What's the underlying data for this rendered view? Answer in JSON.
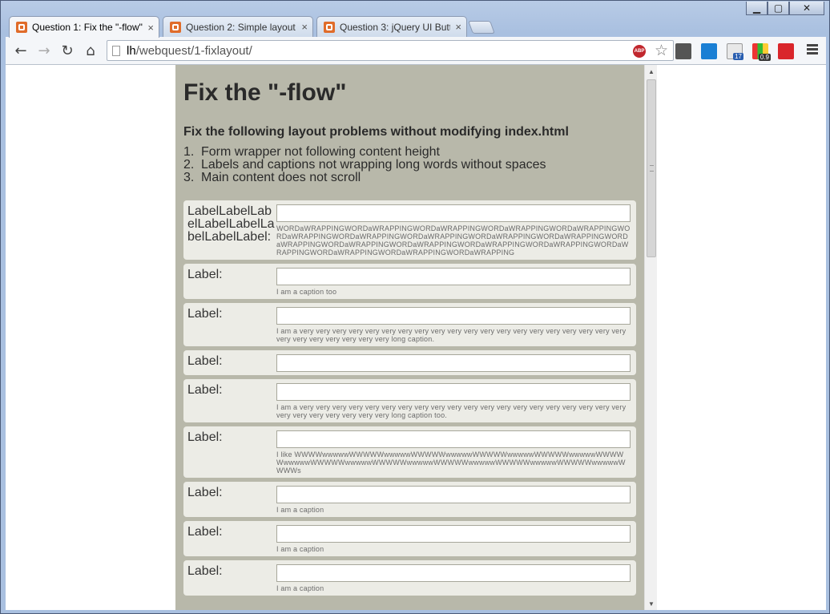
{
  "window": {
    "minimize_glyph": "▁",
    "maximize_glyph": "▢",
    "close_glyph": "✕"
  },
  "tabs": [
    {
      "label": "Question 1: Fix the \"-flow\"",
      "close": "×",
      "active": true
    },
    {
      "label": "Question 2: Simple layout",
      "close": "×",
      "active": false
    },
    {
      "label": "Question 3: jQuery UI Butt",
      "close": "×",
      "active": false
    }
  ],
  "toolbar": {
    "back_glyph": "←",
    "forward_glyph": "→",
    "reload_glyph": "↻",
    "home_glyph": "⌂",
    "url_host": "lh",
    "url_path": "/webquest/1-fixlayout/",
    "abp_label": "ABP",
    "star_glyph": "☆",
    "ext_badge_1": "17",
    "ext_badge_2": "0.9"
  },
  "page": {
    "title": "Fix the \"-flow\"",
    "subtitle": "Fix the following layout problems without modifying index.html",
    "problems": [
      {
        "num": "1.",
        "text": "Form wrapper not following content height"
      },
      {
        "num": "2.",
        "text": "Labels and captions not wrapping long words without spaces"
      },
      {
        "num": "3.",
        "text": "Main content does not scroll"
      }
    ],
    "rows": [
      {
        "label": "LabelLabelLabelLabelLabelLabelLabelLabel:",
        "value": "",
        "caption": "WORDaWRAPPINGWORDaWRAPPINGWORDaWRAPPINGWORDaWRAPPINGWORDaWRAPPINGWORDaWRAPPINGWORDaWRAPPINGWORDaWRAPPINGWORDaWRAPPINGWORDaWRAPPINGWORDaWRAPPINGWORDaWRAPPINGWORDaWRAPPINGWORDaWRAPPINGWORDaWRAPPINGWORDaWRAPPINGWORDaWRAPPINGWORDaWRAPPINGWORDaWRAPPING"
      },
      {
        "label": "Label:",
        "value": "",
        "caption": "I am a caption too"
      },
      {
        "label": "Label:",
        "value": "",
        "caption": "I am a very very very very very very very very very very very very very very very very very very very very very very very very very very very long caption."
      },
      {
        "label": "Label:",
        "value": "",
        "caption": ""
      },
      {
        "label": "Label:",
        "value": "",
        "caption": "I am a very very very very very very very very very very very very very very very very very very very very very very very very very very very long caption too."
      },
      {
        "label": "Label:",
        "value": "",
        "caption": "I like WWWWwwwwwWWWWWwwwwwWWWWWwwwwwWWWWWwwwwwWWWWWwwwwwWWWWWwwwwwWWWWWwwwwwWWWWWwwwwwWWWWWwwwwwWWWWWwwwwwWWWWWwwwwwWWWWs"
      },
      {
        "label": "Label:",
        "value": "",
        "caption": "I am a caption"
      },
      {
        "label": "Label:",
        "value": "",
        "caption": "I am a caption"
      },
      {
        "label": "Label:",
        "value": "",
        "caption": "I am a caption"
      }
    ]
  },
  "scrollbar": {
    "up_glyph": "▲",
    "down_glyph": "▼"
  },
  "colors": {
    "container_bg": "#b8b8aa",
    "row_bg": "#ececE6",
    "tab_favicon": "#e06c2a"
  },
  "icons": [
    "back-icon",
    "forward-icon",
    "reload-icon",
    "home-icon",
    "page-icon",
    "adblock-icon",
    "bookmark-star-icon",
    "menu-icon"
  ]
}
